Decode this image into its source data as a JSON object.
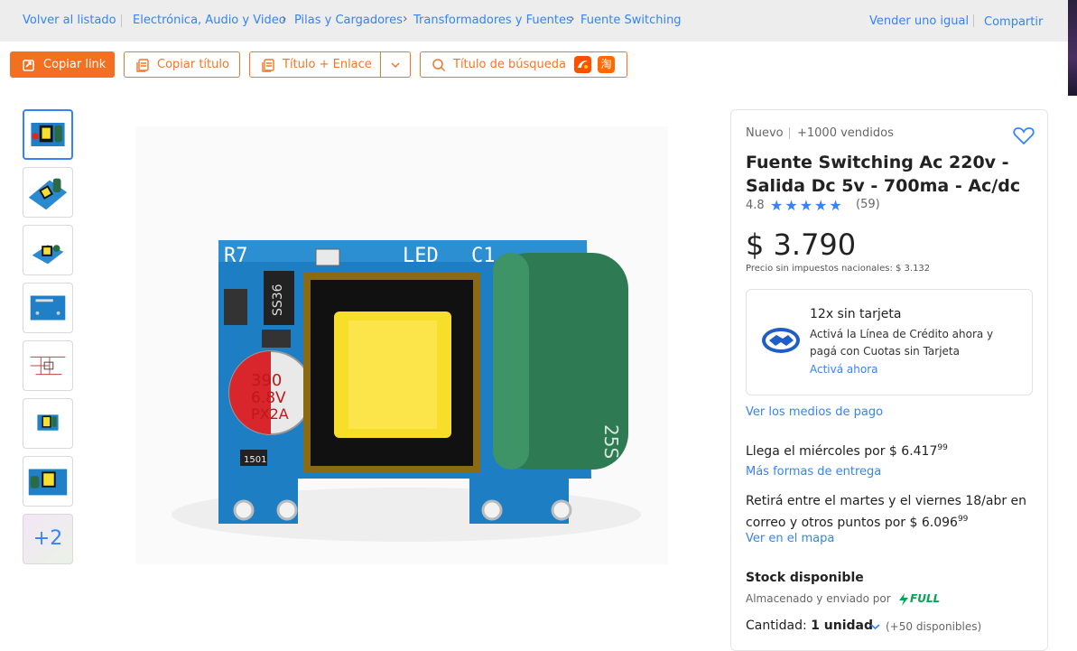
{
  "breadcrumb": {
    "back": "Volver al listado",
    "items": [
      "Electrónica, Audio y Video",
      "Pilas y Cargadores",
      "Transformadores y Fuentes",
      "Fuente Switching"
    ],
    "sell": "Vender uno igual",
    "share": "Compartir"
  },
  "toolbar": {
    "copy_link": "Copiar link",
    "copy_title": "Copiar título",
    "title_link": "Título + Enlace",
    "search_title": "Título de búsqueda",
    "taobao_glyph": "淘"
  },
  "gallery": {
    "more_label": "+2"
  },
  "product": {
    "condition": "Nuevo",
    "sold": "+1000 vendidos",
    "title_line1": "Fuente Switching Ac 220v -",
    "title_line2": "Salida Dc 5v - 700ma - Ac/dc",
    "rating": "4.8",
    "stars": 4.8,
    "reviews": "(59)",
    "price": "$ 3.790",
    "tax_note": "Precio sin impuestos nacionales: $ 3.132"
  },
  "credit": {
    "title": "12x sin tarjeta",
    "desc_line1": "Activá la Línea de Crédito ahora y",
    "desc_line2": "pagá con Cuotas sin Tarjeta",
    "link": "Activá ahora"
  },
  "payment_link": "Ver los medios de pago",
  "shipping": {
    "arrival": "Llega el miércoles por $ 6.417",
    "arrival_cents": "99",
    "more_link": "Más formas de entrega",
    "pickup_line1": "Retirá entre el martes y el viernes 18/abr en",
    "pickup_line2": "correo y otros puntos por $ 6.096",
    "pickup_cents": "99",
    "map_link": "Ver en el mapa"
  },
  "stock": {
    "title": "Stock disponible",
    "stored_by": "Almacenado y enviado por",
    "full": "FULL",
    "qty_label": "Cantidad:",
    "qty_value": "1 unidad",
    "available": "(+50 disponibles)"
  },
  "colors": {
    "accent": "#3483fa",
    "orange": "#f36f21",
    "full_green": "#00a650"
  }
}
